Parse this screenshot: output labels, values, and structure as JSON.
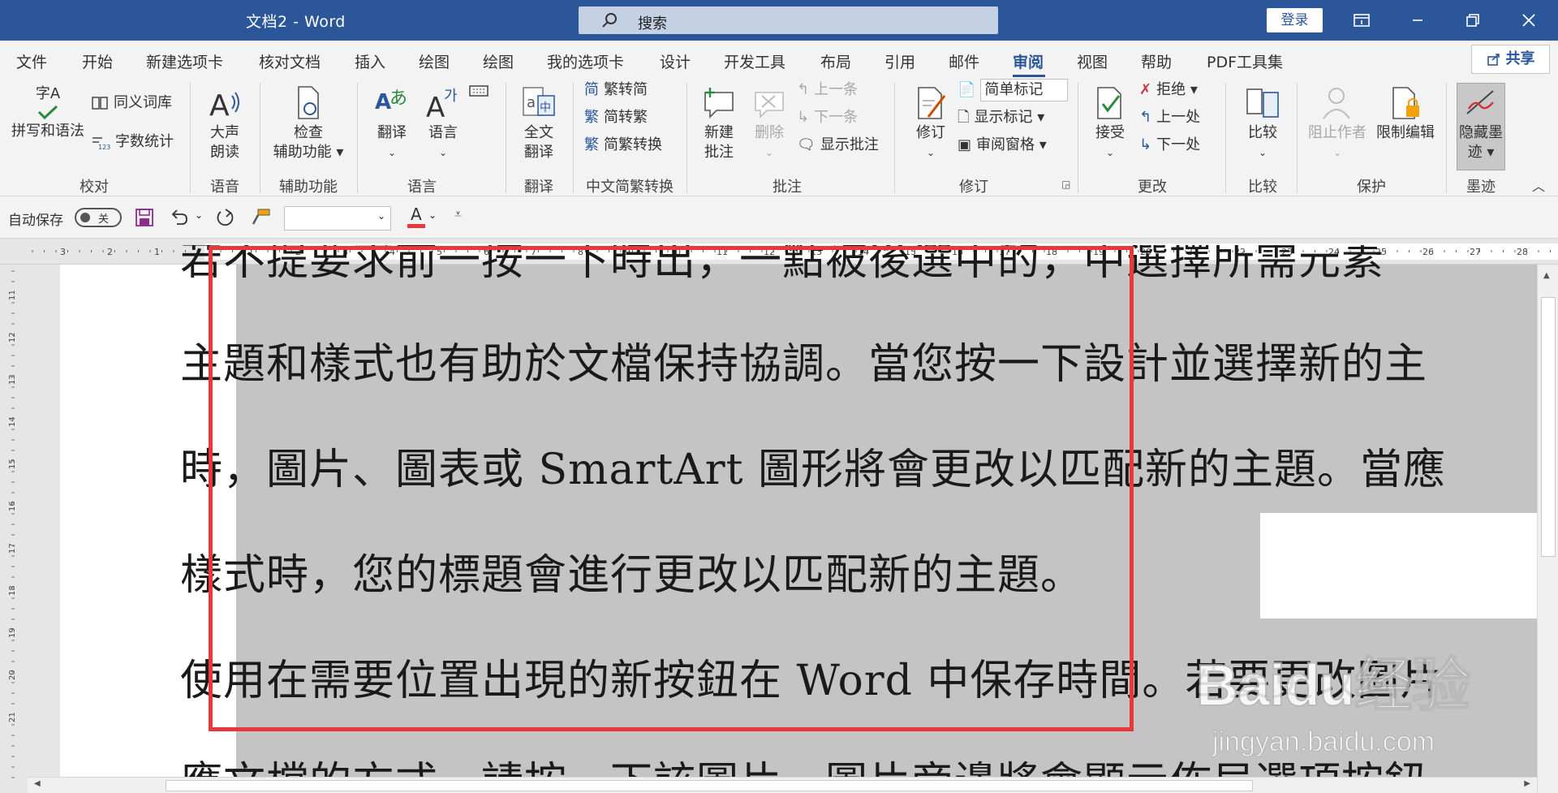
{
  "window": {
    "title": "文档2  -  Word",
    "search_placeholder": "搜索",
    "login_label": "登录",
    "buttons": [
      "ribbon-display-icon",
      "minimize-icon",
      "restore-icon",
      "close-icon"
    ]
  },
  "menu": {
    "tabs": [
      "文件",
      "开始",
      "新建选项卡",
      "核对文档",
      "插入",
      "绘图",
      "绘图",
      "我的选项卡",
      "设计",
      "开发工具",
      "布局",
      "引用",
      "邮件",
      "审阅",
      "视图",
      "帮助",
      "PDF工具集"
    ],
    "active_tab": "审阅",
    "share_label": "共享"
  },
  "ribbon": {
    "groups": {
      "proofing": {
        "label": "校对",
        "spelling": "拼写和语法",
        "spell_top": "字A",
        "thesaurus": "同义词库",
        "wordcount": "字数统计"
      },
      "speech": {
        "label": "语音",
        "read_aloud_1": "大声",
        "read_aloud_2": "朗读"
      },
      "accessibility": {
        "label": "辅助功能",
        "check_1": "检查",
        "check_2": "辅助功能 ▾"
      },
      "language": {
        "label": "语言",
        "translate": "翻译",
        "language": "语言"
      },
      "translate": {
        "label": "翻译",
        "full_1": "全文",
        "full_2": "翻译"
      },
      "chinese": {
        "label": "中文简繁转换",
        "t2s": "繁转简",
        "s2t": "简转繁",
        "convert": "简繁转换"
      },
      "comments": {
        "label": "批注",
        "new_1": "新建",
        "new_2": "批注",
        "delete": "删除",
        "prev": "上一条",
        "next": "下一条",
        "show": "显示批注"
      },
      "tracking": {
        "label": "修订",
        "track": "修订",
        "markup_value": "简单标记",
        "show_markup": "显示标记 ▾",
        "pane": "审阅窗格 ▾"
      },
      "changes": {
        "label": "更改",
        "accept": "接受",
        "reject": "拒绝 ▾",
        "prev": "上一处",
        "next": "下一处"
      },
      "compare": {
        "label": "比较",
        "compare": "比较"
      },
      "protect": {
        "label": "保护",
        "block": "阻止作者",
        "restrict": "限制编辑"
      },
      "ink": {
        "label": "墨迹",
        "hide_1": "隐藏墨",
        "hide_2": "迹 ▾"
      }
    }
  },
  "qat": {
    "autosave_label": "自动保存",
    "autosave_state": "关",
    "font_color_letter": "A",
    "font_color": "#e8383d"
  },
  "ruler": {
    "h_left": [
      "3",
      "2",
      "1"
    ],
    "h_right": [
      "1",
      "2",
      "3",
      "4",
      "5",
      "6",
      "7",
      "8",
      "9",
      "10",
      "11",
      "12",
      "13",
      "14",
      "15",
      "16",
      "17",
      "18",
      "19",
      "20",
      "21",
      "22",
      "23",
      "24",
      "25",
      "26",
      "27",
      "28"
    ],
    "v": [
      "11",
      "12",
      "13",
      "14",
      "15",
      "16",
      "17",
      "18",
      "19",
      "20",
      "21"
    ],
    "corner": "L"
  },
  "document": {
    "lines": [
      "主題和樣式也有助於文檔保持協調。當您按一下設計並選擇新的主",
      "時，圖片、圖表或 SmartArt 圖形將會更改以匹配新的主題。當應",
      "樣式時，您的標題會進行更改以匹配新的主題。",
      "使用在需要位置出現的新按鈕在 Word 中保存時間。若要更改圖片",
      "應文檔的方式，請按一下該圖片，圖片旁邊將會顯示佈局選項按鈕"
    ],
    "top_partial": "若不提要求前一按一下時出，一點被後選中的，中選擇所需元素"
  },
  "watermark": {
    "line1": "Baidu经验",
    "line2": "jingyan.baidu.com"
  },
  "colors": {
    "accent": "#2b579a",
    "highlight_box": "#e8383d",
    "selection": "#c4c4c4"
  }
}
